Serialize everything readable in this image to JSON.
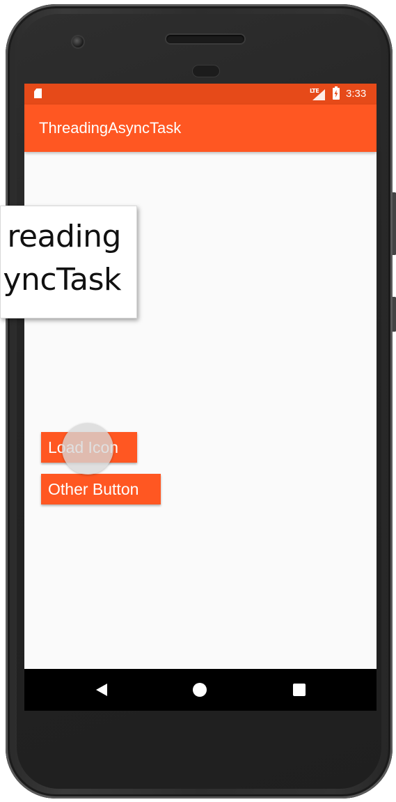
{
  "status_bar": {
    "network": "LTE",
    "time": "3:33"
  },
  "app_bar": {
    "title": "ThreadingAsyncTask"
  },
  "buttons": {
    "load_icon": "Load Icon",
    "other": "Other Button"
  },
  "caption": {
    "line1": "reading",
    "line2": "yncTask"
  },
  "icons": {
    "status_left": "sd-card-icon",
    "signal": "signal-icon",
    "battery": "battery-charging-icon",
    "nav_back": "back-icon",
    "nav_home": "home-icon",
    "nav_recent": "recents-icon"
  },
  "colors": {
    "primary": "#ff5722",
    "primary_dark": "#e64a19",
    "background": "#fafafa"
  }
}
